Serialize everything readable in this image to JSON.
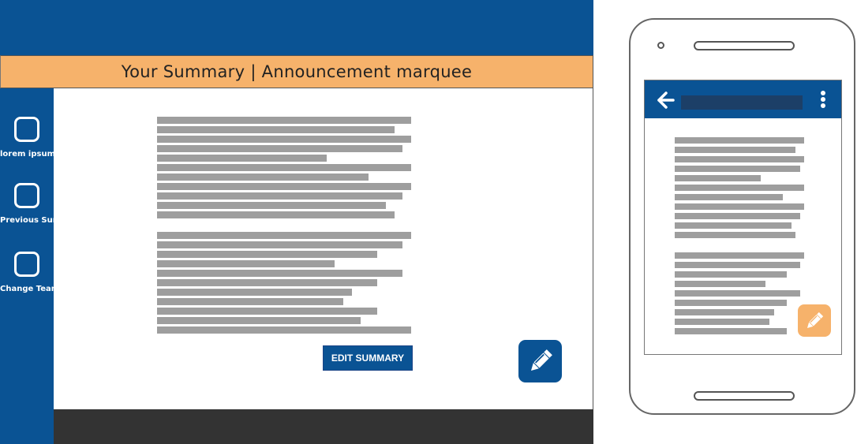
{
  "desktop": {
    "marquee_text": "Your Summary | Announcement marquee",
    "sidebar": {
      "items": [
        {
          "label": "lorem ipsum",
          "icon": "square-icon"
        },
        {
          "label": "Previous Summary",
          "icon": "square-icon"
        },
        {
          "label": "Change Team",
          "icon": "square-icon"
        }
      ]
    },
    "edit_button_label": "EDIT SUMMARY",
    "fab_icon": "pencil-icon"
  },
  "mobile": {
    "back_icon": "arrow-left-icon",
    "menu_icon": "kebab-menu-icon",
    "fab_icon": "pencil-icon"
  },
  "colors": {
    "primary_blue": "#0a5394",
    "accent_orange": "#f6b26b",
    "footer_dark": "#333333",
    "placeholder_text_gray": "#9e9e9e"
  }
}
